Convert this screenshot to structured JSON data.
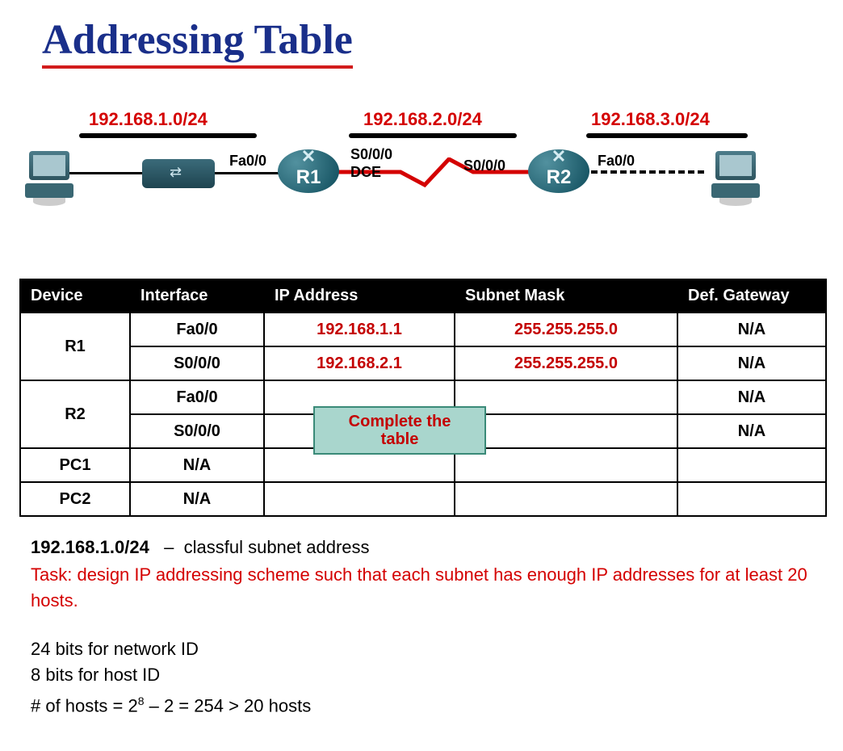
{
  "title": "Addressing Table",
  "topology": {
    "subnets": [
      {
        "label": "192.168.1.0/24"
      },
      {
        "label": "192.168.2.0/24"
      },
      {
        "label": "192.168.3.0/24"
      }
    ],
    "nodes": {
      "pc1": "PC1",
      "pc2": "PC2",
      "r1": "R1",
      "r2": "R2"
    },
    "interfaces": {
      "r1_fa": "Fa0/0",
      "r1_s_top": "S0/0/0",
      "r1_s_bot": "DCE",
      "r2_s": "S0/0/0",
      "r2_fa": "Fa0/0"
    }
  },
  "table": {
    "headers": [
      "Device",
      "Interface",
      "IP Address",
      "Subnet Mask",
      "Def. Gateway"
    ],
    "rows": [
      {
        "device": "R1",
        "rowspan": 2,
        "iface": "Fa0/0",
        "ip": "192.168.1.1",
        "mask": "255.255.255.0",
        "gw": "N/A",
        "hl": true
      },
      {
        "device": "",
        "iface": "S0/0/0",
        "ip": "192.168.2.1",
        "mask": "255.255.255.0",
        "gw": "N/A",
        "hl": true
      },
      {
        "device": "R2",
        "rowspan": 2,
        "iface": "Fa0/0",
        "ip": "",
        "mask": "",
        "gw": "N/A"
      },
      {
        "device": "",
        "iface": "S0/0/0",
        "ip": "",
        "mask": "",
        "gw": "N/A"
      },
      {
        "device": "PC1",
        "iface": "N/A",
        "ip": "",
        "mask": "",
        "gw": ""
      },
      {
        "device": "PC2",
        "iface": "N/A",
        "ip": "",
        "mask": "",
        "gw": ""
      }
    ],
    "callout": "Complete the table"
  },
  "notes": {
    "classful_net": "192.168.1.0/24",
    "classful_txt": "classful subnet address",
    "task": "Task: design IP addressing scheme such that each subnet has enough IP addresses for at least 20 hosts.",
    "calc1": "24 bits for network ID",
    "calc2": "8 bits for host ID",
    "calc3_pre": "# of hosts = 2",
    "calc3_exp": "8",
    "calc3_post": " – 2 = 254 > 20 hosts"
  }
}
